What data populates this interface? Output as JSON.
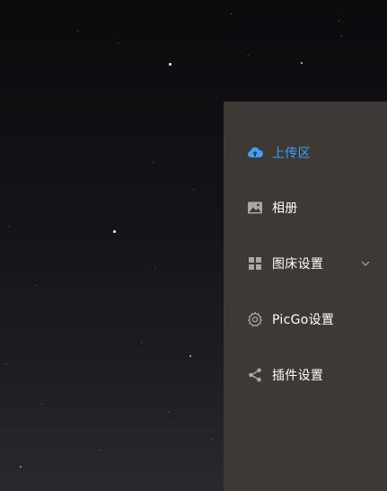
{
  "menu": {
    "items": [
      {
        "label": "上传区",
        "icon": "cloud-upload-icon",
        "active": true
      },
      {
        "label": "相册",
        "icon": "image-icon",
        "active": false
      },
      {
        "label": "图床设置",
        "icon": "grid-icon",
        "active": false,
        "has_submenu": true
      },
      {
        "label": "PicGo设置",
        "icon": "gear-icon",
        "active": false
      },
      {
        "label": "插件设置",
        "icon": "share-icon",
        "active": false
      }
    ]
  },
  "colors": {
    "active": "#409eff",
    "text": "#ffffff",
    "icon": "#a8a8a8",
    "panel_bg": "#3d3a36"
  }
}
